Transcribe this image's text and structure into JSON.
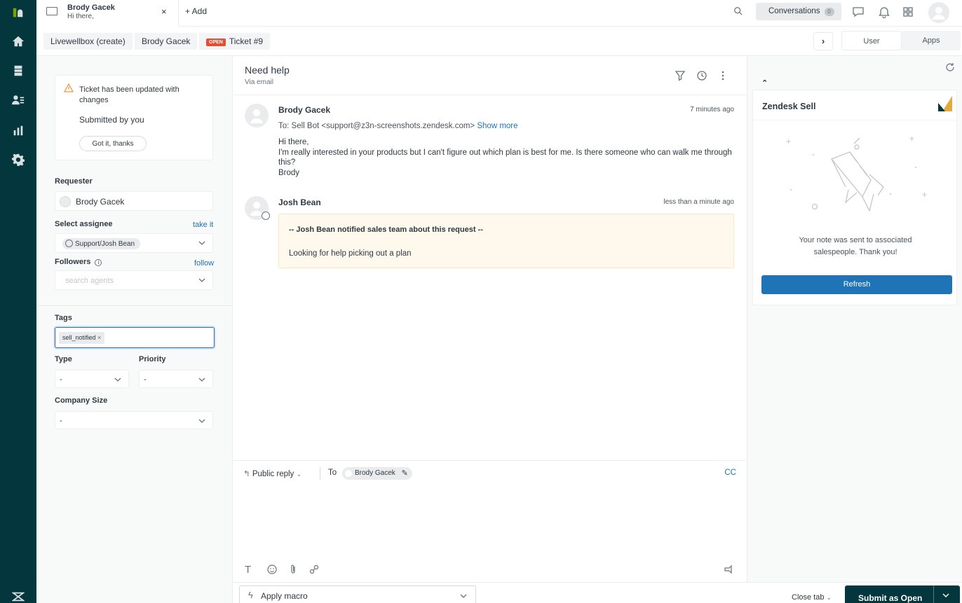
{
  "colors": {
    "nav": "#03363d",
    "accent": "#1f73b7",
    "open_badge": "#e34f32",
    "note_bg": "#fff8ed"
  },
  "top": {
    "tab_name": "Brody Gacek",
    "tab_preview": "Hi there,",
    "tab_close": "×",
    "add_label": "+ Add",
    "conversations_label": "Conversations",
    "conversations_count": "0"
  },
  "breadcrumbs": {
    "org": "Livewellbox (create)",
    "requester": "Brody Gacek",
    "status_badge": "OPEN",
    "ticket": "Ticket #9"
  },
  "side_tabs": {
    "user": "User",
    "apps": "Apps"
  },
  "notice": {
    "headline": "Ticket has been updated with changes",
    "sub": "Submitted by you",
    "button": "Got it, thanks"
  },
  "fields": {
    "requester_label": "Requester",
    "requester_value": "Brody Gacek",
    "assignee_label": "Select assignee",
    "assignee_link": "take it",
    "assignee_value": "Support/Josh Bean",
    "followers_label": "Followers",
    "followers_link": "follow",
    "followers_placeholder": "search agents",
    "tags_label": "Tags",
    "tag": "sell_notified",
    "type_label": "Type",
    "type_value": "-",
    "priority_label": "Priority",
    "priority_value": "-",
    "company_size_label": "Company Size",
    "company_size_value": "-"
  },
  "ticket": {
    "subject": "Need help",
    "channel": "Via email"
  },
  "messages": [
    {
      "author": "Brody Gacek",
      "time": "7 minutes ago",
      "to": "To: Sell Bot <support@z3n-screenshots.zendesk.com>",
      "show_more": "Show more",
      "lines": [
        "Hi there,",
        "I'm really interested in your products but I can't figure out which plan is best for me. Is there someone who can walk me through this?",
        "Brody"
      ]
    },
    {
      "author": "Josh Bean",
      "time": "less than a minute ago",
      "note_title": "-- Josh Bean notified sales team about this request --",
      "note_body": "Looking for help picking out a plan"
    }
  ],
  "reply": {
    "mode": "Public reply",
    "to_label": "To",
    "recipient": "Brody Gacek",
    "cc": "CC"
  },
  "footer": {
    "macro": "Apply macro",
    "close_tab": "Close tab",
    "submit": "Submit as Open"
  },
  "app": {
    "title": "Zendesk Sell",
    "message": "Your note was sent to associated salespeople. Thank you!",
    "button": "Refresh"
  }
}
